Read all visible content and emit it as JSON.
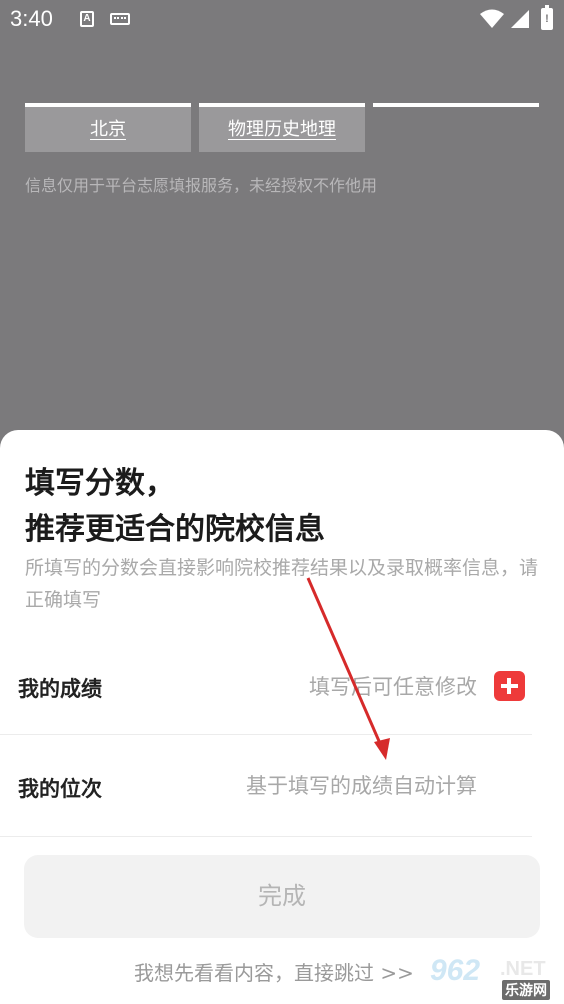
{
  "status_bar": {
    "time": "3:40",
    "input_indicator": "A",
    "battery_label": "!",
    "icons": [
      "text-input-icon",
      "keyboard-icon",
      "wifi-icon",
      "signal-icon",
      "battery-icon"
    ]
  },
  "background_form": {
    "region_value": "北京",
    "subjects_value": "物理历史地理",
    "privacy_notice": "信息仅用于平台志愿填报服务，未经授权不作他用"
  },
  "sheet": {
    "title_line1": "填写分数，",
    "title_line2": "推荐更适合的院校信息",
    "description": "所填写的分数会直接影响院校推荐结果以及录取概率信息，请正确填写",
    "score_row": {
      "label": "我的成绩",
      "placeholder": "填写后可任意修改",
      "action_icon": "plus-icon"
    },
    "rank_row": {
      "label": "我的位次",
      "placeholder": "基于填写的成绩自动计算"
    },
    "done_label": "完成",
    "skip_label": "我想先看看内容，直接跳过 >>"
  },
  "annotation": {
    "arrow_color": "#d62a2a"
  },
  "watermark": {
    "number": "962",
    "suffix": ".NET",
    "site_cn": "乐游网"
  },
  "colors": {
    "overlay": "#7b7a7c",
    "accent_red": "#ee3a3a",
    "sheet_bg": "#ffffff",
    "button_bg": "#f2f2f2"
  }
}
